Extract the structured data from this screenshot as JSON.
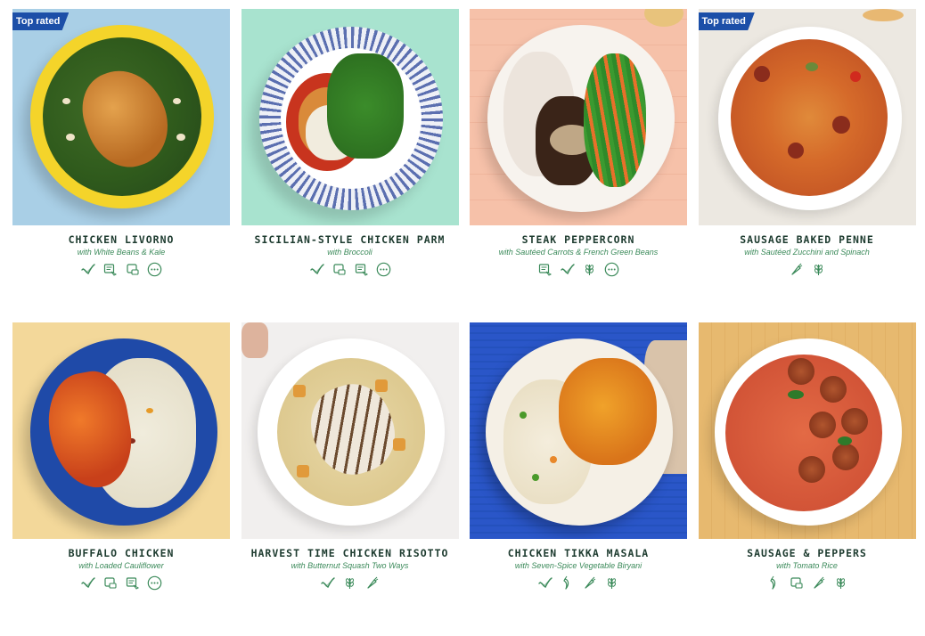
{
  "badges": {
    "top_rated": "Top rated"
  },
  "meals": [
    {
      "title": "CHICKEN LIVORNO",
      "subtitle": "with White Beans & Kale",
      "top_rated": true,
      "icons": [
        "heart-check-icon",
        "calorie-smart-icon",
        "protein-icon",
        "more-icon"
      ]
    },
    {
      "title": "SICILIAN-STYLE CHICKEN PARM",
      "subtitle": "with Broccoli",
      "top_rated": false,
      "icons": [
        "heart-check-icon",
        "protein-icon",
        "calorie-smart-icon",
        "more-icon"
      ]
    },
    {
      "title": "STEAK PEPPERCORN",
      "subtitle": "with Sautéed Carrots & French Green Beans",
      "top_rated": false,
      "icons": [
        "calorie-smart-icon",
        "heart-check-icon",
        "wheat-icon",
        "more-icon"
      ]
    },
    {
      "title": "SAUSAGE BAKED PENNE",
      "subtitle": "with Sautéed Zucchini and Spinach",
      "top_rated": true,
      "icons": [
        "carrot-icon",
        "wheat-icon"
      ]
    },
    {
      "title": "BUFFALO CHICKEN",
      "subtitle": "with Loaded Cauliflower",
      "top_rated": false,
      "icons": [
        "heart-check-icon",
        "protein-icon",
        "calorie-smart-icon",
        "more-icon"
      ]
    },
    {
      "title": "HARVEST TIME CHICKEN RISOTTO",
      "subtitle": "with Butternut Squash Two Ways",
      "top_rated": false,
      "icons": [
        "heart-check-icon",
        "wheat-icon",
        "carrot-icon"
      ]
    },
    {
      "title": "CHICKEN TIKKA MASALA",
      "subtitle": "with Seven-Spice Vegetable Biryani",
      "top_rated": false,
      "icons": [
        "heart-check-icon",
        "chili-icon",
        "carrot-icon",
        "wheat-icon"
      ]
    },
    {
      "title": "SAUSAGE & PEPPERS",
      "subtitle": "with Tomato Rice",
      "top_rated": false,
      "icons": [
        "chili-icon",
        "protein-icon",
        "carrot-icon",
        "wheat-icon"
      ]
    }
  ],
  "colors": {
    "title": "#1d3b2f",
    "subtitle": "#3b8a5a",
    "icon": "#3b8a5a",
    "badge": "#1c4fa8"
  }
}
